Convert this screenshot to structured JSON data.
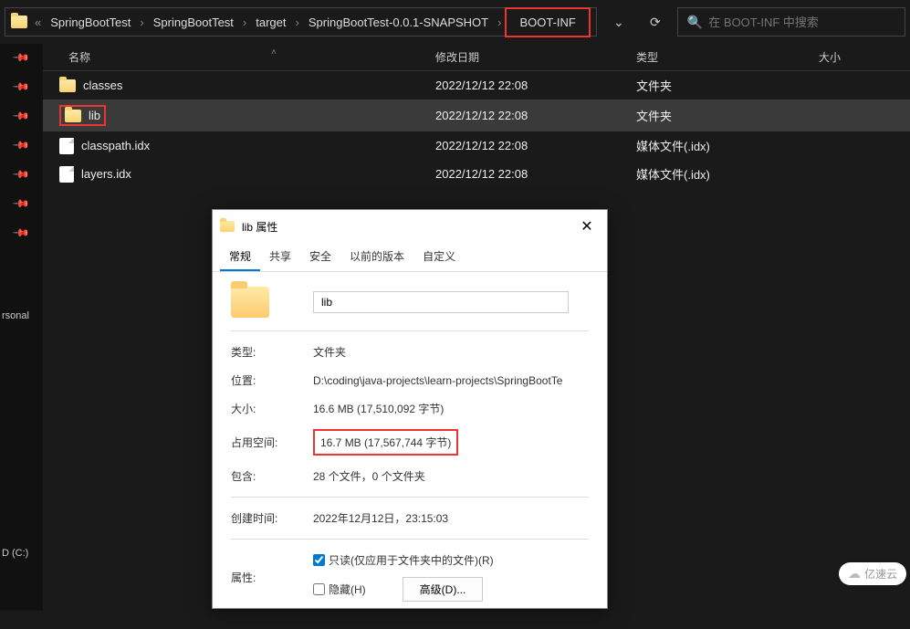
{
  "breadcrumb": {
    "items": [
      "SpringBootTest",
      "SpringBootTest",
      "target",
      "SpringBootTest-0.0.1-SNAPSHOT",
      "BOOT-INF"
    ]
  },
  "search": {
    "placeholder": "在 BOOT-INF 中搜索"
  },
  "columns": {
    "name": "名称",
    "date": "修改日期",
    "type": "类型",
    "size": "大小"
  },
  "rows": [
    {
      "icon": "folder",
      "name": "classes",
      "date": "2022/12/12 22:08",
      "type": "文件夹",
      "selected": false
    },
    {
      "icon": "folder",
      "name": "lib",
      "date": "2022/12/12 22:08",
      "type": "文件夹",
      "selected": true
    },
    {
      "icon": "file",
      "name": "classpath.idx",
      "date": "2022/12/12 22:08",
      "type": "媒体文件(.idx)",
      "selected": false
    },
    {
      "icon": "file",
      "name": "layers.idx",
      "date": "2022/12/12 22:08",
      "type": "媒体文件(.idx)",
      "selected": false
    }
  ],
  "sidebar": {
    "personal": "rsonal",
    "drive": "D (C:)"
  },
  "dialog": {
    "title": "lib 属性",
    "tabs": [
      "常规",
      "共享",
      "安全",
      "以前的版本",
      "自定义"
    ],
    "name_value": "lib",
    "labels": {
      "type": "类型:",
      "location": "位置:",
      "size": "大小:",
      "size_on_disk": "占用空间:",
      "contains": "包含:",
      "created": "创建时间:",
      "attributes": "属性:"
    },
    "values": {
      "type": "文件夹",
      "location": "D:\\coding\\java-projects\\learn-projects\\SpringBootTe",
      "size": "16.6 MB (17,510,092 字节)",
      "size_on_disk": "16.7 MB (17,567,744 字节)",
      "contains": "28 个文件，0 个文件夹",
      "created": "2022年12月12日，23:15:03"
    },
    "readonly_label": "只读(仅应用于文件夹中的文件)(R)",
    "hidden_label": "隐藏(H)",
    "advanced_label": "高级(D)..."
  },
  "watermark": "亿速云"
}
